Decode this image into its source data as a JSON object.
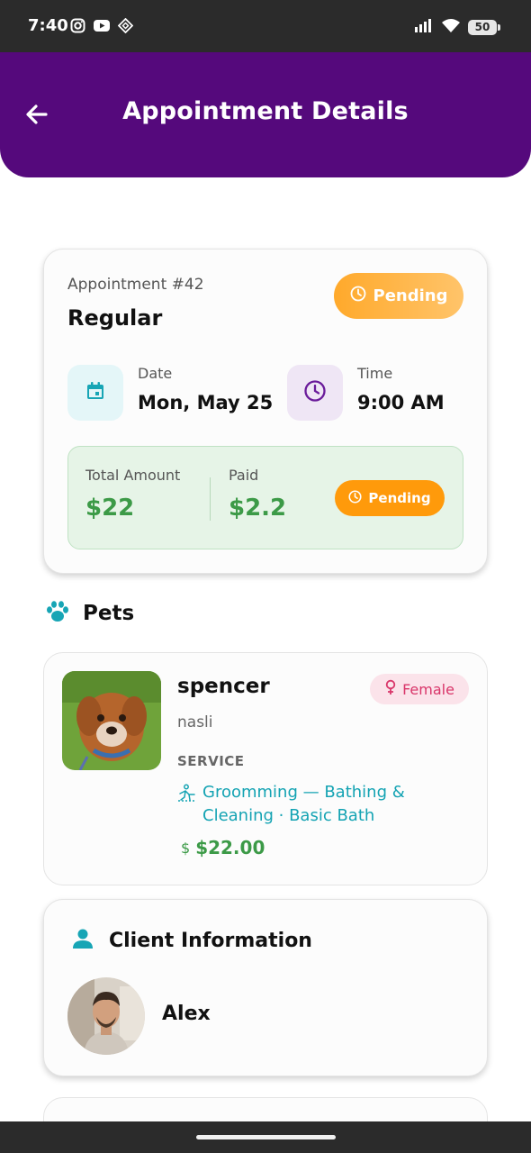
{
  "status_bar": {
    "time": "7:40",
    "battery": "50",
    "icons": [
      "instagram-icon",
      "youtube-icon",
      "app-icon",
      "signal-icon",
      "wifi-icon",
      "battery-icon"
    ]
  },
  "header": {
    "title": "Appointment Details",
    "back_icon": "arrow-left-icon",
    "background": "#55097c"
  },
  "appointment": {
    "number": "Appointment #42",
    "type": "Regular",
    "status": "Pending",
    "date_label": "Date",
    "date_value": "Mon, May 25",
    "time_label": "Time",
    "time_value": "9:00 AM",
    "total_label": "Total Amount",
    "total_value": "$22",
    "paid_label": "Paid",
    "paid_value": "$2.2",
    "payment_status": "Pending"
  },
  "pets_section": {
    "title": "Pets",
    "icon": "paw-icon",
    "pets": [
      {
        "name": "spencer",
        "breed": "nasli",
        "gender": "Female",
        "service_label": "SERVICE",
        "service": "Groomming — Bathing & Cleaning · Basic Bath",
        "price": "$22.00"
      }
    ]
  },
  "client_section": {
    "title": "Client Information",
    "icon": "person-icon",
    "name": "Alex"
  },
  "colors": {
    "accent": "#55097c",
    "pending": "#ff9a0b",
    "money": "#3c9a47",
    "teal": "#14a3b3",
    "female": "#d9366a"
  }
}
